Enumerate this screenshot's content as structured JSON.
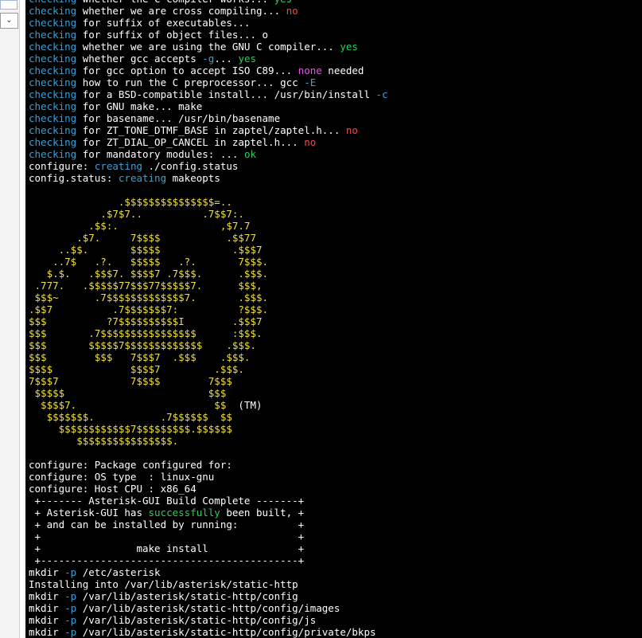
{
  "colors": {
    "background": "#000000",
    "text": "#ffffff",
    "cyan": "#3aa0d8",
    "green": "#2ad05a",
    "red": "#f04a4a",
    "magenta": "#e25ae2",
    "yellow": "#f0e040"
  },
  "left_panel": {
    "dropdown_icon": "chevron-down-icon"
  },
  "terminal": {
    "lines": [
      [
        [
          "c",
          "checking"
        ],
        [
          "w",
          " whether the C compiler works... "
        ],
        [
          "g",
          "yes"
        ]
      ],
      [
        [
          "c",
          "checking"
        ],
        [
          "w",
          " whether we are cross compiling... "
        ],
        [
          "r",
          "no"
        ]
      ],
      [
        [
          "c",
          "checking"
        ],
        [
          "w",
          " for suffix of executables... "
        ]
      ],
      [
        [
          "c",
          "checking"
        ],
        [
          "w",
          " for suffix of object files... o"
        ]
      ],
      [
        [
          "c",
          "checking"
        ],
        [
          "w",
          " whether we are using the GNU C compiler... "
        ],
        [
          "g",
          "yes"
        ]
      ],
      [
        [
          "c",
          "checking"
        ],
        [
          "w",
          " whether gcc accepts "
        ],
        [
          "c",
          "-g"
        ],
        [
          "w",
          "... "
        ],
        [
          "g",
          "yes"
        ]
      ],
      [
        [
          "c",
          "checking"
        ],
        [
          "w",
          " for gcc option to accept ISO C89... "
        ],
        [
          "m",
          "none"
        ],
        [
          "w",
          " needed"
        ]
      ],
      [
        [
          "c",
          "checking"
        ],
        [
          "w",
          " how to run the C preprocessor... gcc "
        ],
        [
          "c",
          "-E"
        ]
      ],
      [
        [
          "c",
          "checking"
        ],
        [
          "w",
          " for a BSD-compatible install... /usr/bin/install "
        ],
        [
          "c",
          "-c"
        ]
      ],
      [
        [
          "c",
          "checking"
        ],
        [
          "w",
          " for GNU make... make"
        ]
      ],
      [
        [
          "c",
          "checking"
        ],
        [
          "w",
          " for basename... /usr/bin/basename"
        ]
      ],
      [
        [
          "c",
          "checking"
        ],
        [
          "w",
          " for ZT_TONE_DTMF_BASE in zaptel/zaptel.h... "
        ],
        [
          "r",
          "no"
        ]
      ],
      [
        [
          "c",
          "checking"
        ],
        [
          "w",
          " for ZT_DIAL_OP_CANCEL in zaptel.h... "
        ],
        [
          "r",
          "no"
        ]
      ],
      [
        [
          "c",
          "checking"
        ],
        [
          "w",
          " for mandatory modules: ... "
        ],
        [
          "g",
          "ok"
        ]
      ],
      [
        [
          "w",
          "configure: "
        ],
        [
          "c",
          "creating"
        ],
        [
          "w",
          " ./config.status"
        ]
      ],
      [
        [
          "w",
          "config.status: "
        ],
        [
          "c",
          "creating"
        ],
        [
          "w",
          " makeopts"
        ]
      ],
      [
        [
          "w",
          " "
        ]
      ],
      [
        [
          "y",
          "               .$$$$$$$$$$$$$$$=.."
        ]
      ],
      [
        [
          "y",
          "            .$7$7..          .7$$7:."
        ]
      ],
      [
        [
          "y",
          "          .$$:.                 ,$7.7"
        ]
      ],
      [
        [
          "y",
          "        .$7.     7$$$$           .$$77"
        ]
      ],
      [
        [
          "y",
          "     ..$$.       $$$$$            .$$$7"
        ]
      ],
      [
        [
          "y",
          "    ..7$   .?.   $$$$$   .?.       7$$$."
        ]
      ],
      [
        [
          "y",
          "   $.$.   .$$$7. $$$$7 .7$$$.      .$$$."
        ]
      ],
      [
        [
          "y",
          " .777.   .$$$$$77$$$77$$$$$7.      $$$,"
        ]
      ],
      [
        [
          "y",
          " $$$~      .7$$$$$$$$$$$$$7.       .$$$."
        ]
      ],
      [
        [
          "y",
          ".$$7          .7$$$$$$$7:          ?$$$."
        ]
      ],
      [
        [
          "y",
          "$$$          ?7$$$$$$$$$$I        .$$$7"
        ]
      ],
      [
        [
          "y",
          "$$$       .7$$$$$$$$$$$$$$$$      :$$$."
        ]
      ],
      [
        [
          "y",
          "$$$       $$$$$7$$$$$$$$$$$$$    .$$$."
        ]
      ],
      [
        [
          "y",
          "$$$        $$$   7$$$7  .$$$    .$$$."
        ]
      ],
      [
        [
          "y",
          "$$$$             $$$$7         .$$$."
        ]
      ],
      [
        [
          "y",
          "7$$$7            7$$$$        7$$$"
        ]
      ],
      [
        [
          "y",
          " $$$$$                        $$$"
        ]
      ],
      [
        [
          "y",
          "  $$$$7.                       $$  "
        ],
        [
          "w",
          "(TM)"
        ]
      ],
      [
        [
          "y",
          "   $$$$$$$.           .7$$$$$$  $$"
        ]
      ],
      [
        [
          "y",
          "     $$$$$$$$$$$$7$$$$$$$$$.$$$$$$"
        ]
      ],
      [
        [
          "y",
          "        $$$$$$$$$$$$$$$$."
        ]
      ],
      [
        [
          "w",
          " "
        ]
      ],
      [
        [
          "w",
          "configure: Package configured for:"
        ]
      ],
      [
        [
          "w",
          "configure: OS type  : linux-gnu"
        ]
      ],
      [
        [
          "w",
          "configure: Host CPU : x86_64"
        ]
      ],
      [
        [
          "w",
          " +------- Asterisk-GUI Build Complete -------+"
        ]
      ],
      [
        [
          "w",
          " + Asterisk-GUI has "
        ],
        [
          "g",
          "successfully"
        ],
        [
          "w",
          " been built, +"
        ]
      ],
      [
        [
          "w",
          " + and can be installed by running:          +"
        ]
      ],
      [
        [
          "w",
          " +                                           +"
        ]
      ],
      [
        [
          "w",
          " +                make install               +"
        ]
      ],
      [
        [
          "w",
          " +-------------------------------------------+"
        ]
      ],
      [
        [
          "w",
          "mkdir "
        ],
        [
          "c",
          "-p"
        ],
        [
          "w",
          " /etc/asterisk"
        ]
      ],
      [
        [
          "w",
          "Installing into /var/lib/asterisk/static-http"
        ]
      ],
      [
        [
          "w",
          "mkdir "
        ],
        [
          "c",
          "-p"
        ],
        [
          "w",
          " /var/lib/asterisk/static-http/config"
        ]
      ],
      [
        [
          "w",
          "mkdir "
        ],
        [
          "c",
          "-p"
        ],
        [
          "w",
          " /var/lib/asterisk/static-http/config/images"
        ]
      ],
      [
        [
          "w",
          "mkdir "
        ],
        [
          "c",
          "-p"
        ],
        [
          "w",
          " /var/lib/asterisk/static-http/config/js"
        ]
      ],
      [
        [
          "w",
          "mkdir "
        ],
        [
          "c",
          "-p"
        ],
        [
          "w",
          " /var/lib/asterisk/static-http/config/private/bkps"
        ]
      ]
    ]
  }
}
